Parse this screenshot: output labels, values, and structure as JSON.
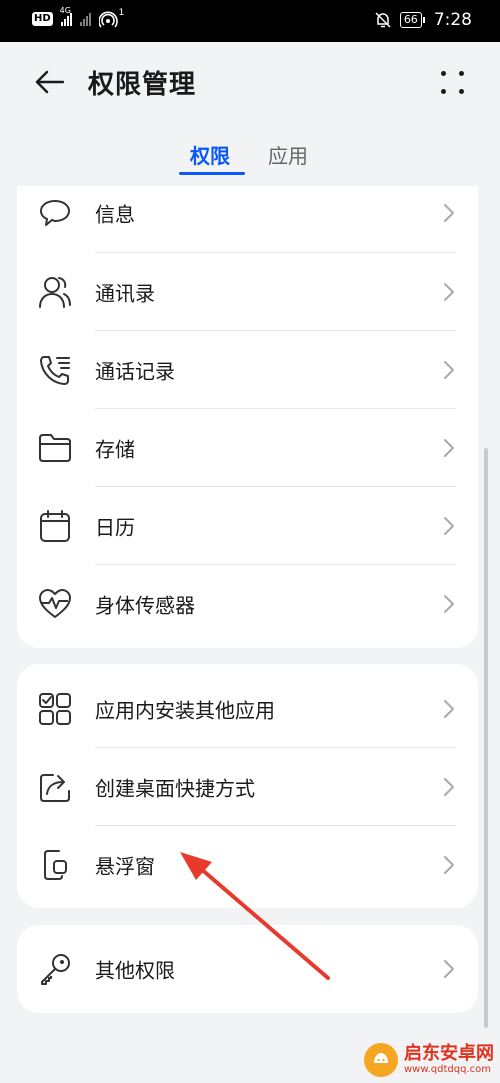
{
  "status_bar": {
    "hd_badge": "HD",
    "net_label": "4G",
    "hotspot_count": "1",
    "battery": "66",
    "time": "7:28"
  },
  "header": {
    "title": "权限管理"
  },
  "tabs": [
    {
      "label": "权限",
      "active": true
    },
    {
      "label": "应用",
      "active": false
    }
  ],
  "permission_groups": [
    {
      "items": [
        {
          "label": "信息",
          "icon": "message-icon"
        },
        {
          "label": "通讯录",
          "icon": "contacts-icon"
        },
        {
          "label": "通话记录",
          "icon": "call-log-icon"
        },
        {
          "label": "存储",
          "icon": "folder-icon"
        },
        {
          "label": "日历",
          "icon": "calendar-icon"
        },
        {
          "label": "身体传感器",
          "icon": "heart-pulse-icon"
        }
      ]
    },
    {
      "items": [
        {
          "label": "应用内安装其他应用",
          "icon": "install-apps-icon"
        },
        {
          "label": "创建桌面快捷方式",
          "icon": "shortcut-icon"
        },
        {
          "label": "悬浮窗",
          "icon": "floating-window-icon"
        }
      ]
    },
    {
      "items": [
        {
          "label": "其他权限",
          "icon": "key-icon"
        }
      ]
    }
  ],
  "watermark": {
    "title": "启东安卓网",
    "url": "www.qdtdqq.com"
  },
  "colors": {
    "accent": "#0a59f7",
    "annotation_arrow": "#e8392d"
  }
}
